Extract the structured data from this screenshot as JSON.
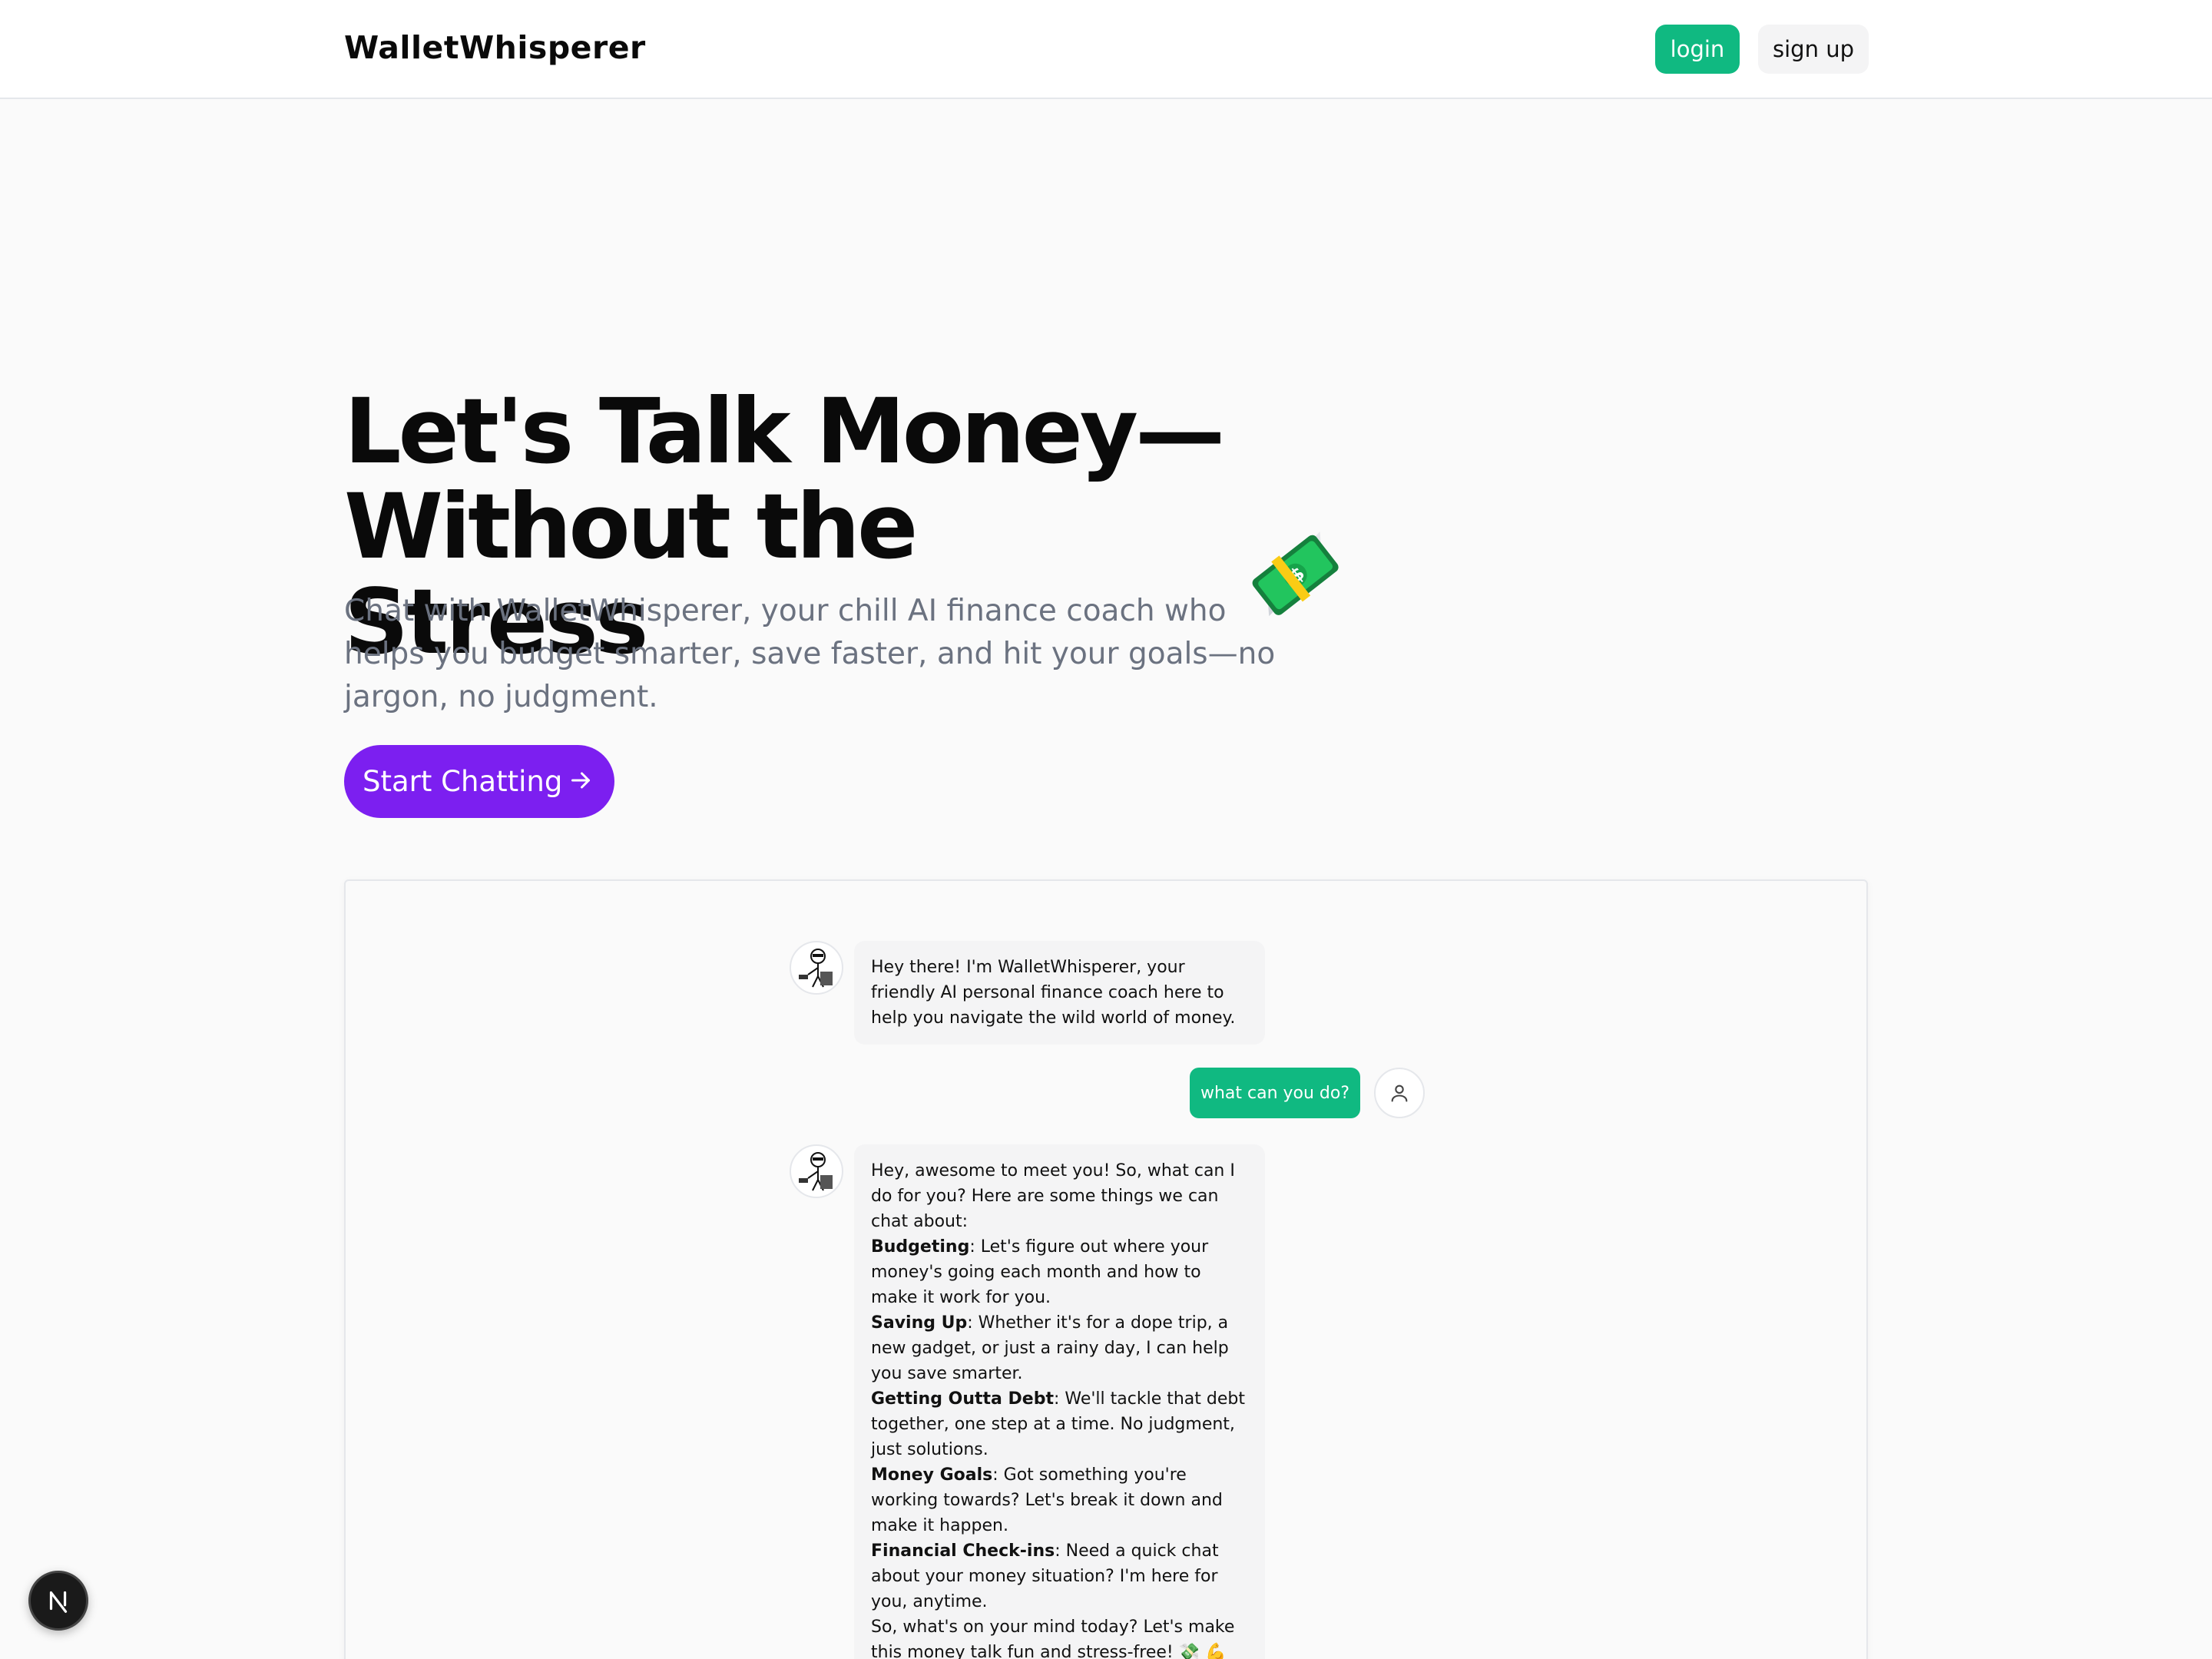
{
  "header": {
    "brand": "WalletWhisperer",
    "login_label": "login",
    "signup_label": "sign up"
  },
  "hero": {
    "title_line1": "Let's Talk Money—",
    "title_line2": "Without the Stress",
    "subtitle": "Chat with WalletWhisperer, your chill AI finance coach who helps you budget smarter, save faster, and hit your goals—no jargon, no judgment.",
    "cta_label": "Start Chatting",
    "accent_color": "#7c1ff0",
    "brand_color": "#10b981"
  },
  "chat": {
    "messages": [
      {
        "role": "assistant",
        "text": "Hey there! I'm WalletWhisperer, your friendly AI personal finance coach here to help you navigate the wild world of money."
      },
      {
        "role": "user",
        "text": "what can you do?"
      },
      {
        "role": "assistant",
        "intro": "Hey, awesome to meet you! So, what can I do for you? Here are some things we can chat about:",
        "items": [
          {
            "title": "Budgeting",
            "text": ": Let's figure out where your money's going each month and how to make it work for you."
          },
          {
            "title": "Saving Up",
            "text": ": Whether it's for a dope trip, a new gadget, or just a rainy day, I can help you save smarter."
          },
          {
            "title": "Getting Outta Debt",
            "text": ": We'll tackle that debt together, one step at a time. No judgment, just solutions."
          },
          {
            "title": "Money Goals",
            "text": ": Got something you're working towards? Let's break it down and make it happen."
          },
          {
            "title": "Financial Check-ins",
            "text": ": Need a quick chat about your money situation? I'm here for you, anytime."
          }
        ],
        "outro": "So, what's on your mind today? Let's make this money talk fun and stress-free! 💸 💪"
      }
    ]
  },
  "icons": {
    "hero_emoji": "money-with-wings-icon",
    "cta_icon": "arrow-right-icon",
    "user_avatar": "user-icon",
    "bot_avatar": "bot-avatar-icon",
    "floating": "nextjs-logo-icon"
  },
  "floating_badge": "N"
}
